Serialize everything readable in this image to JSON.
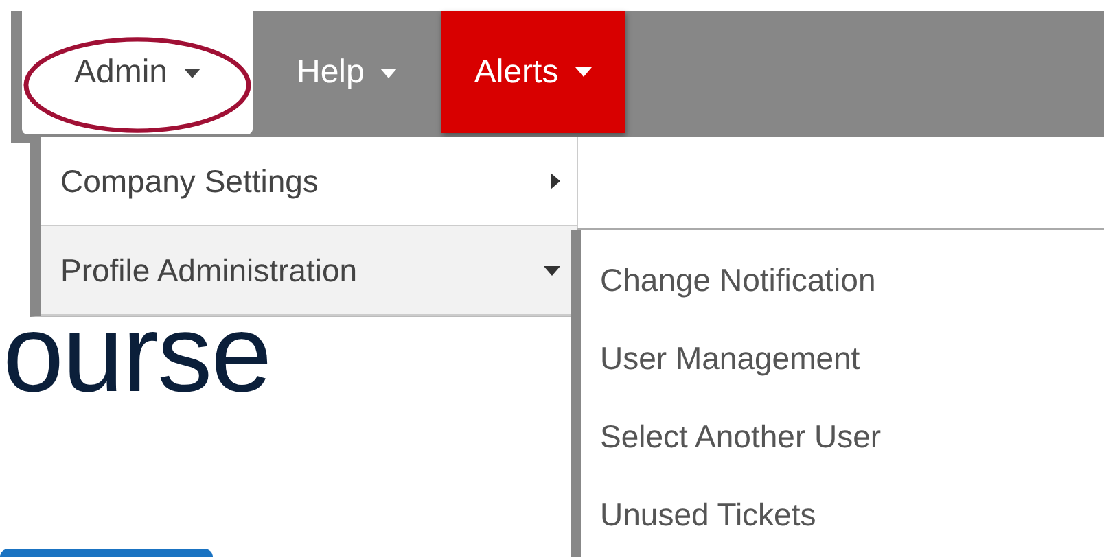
{
  "nav_menu": [
    {
      "label": "Admin",
      "kind": "plain",
      "expanded": true,
      "circled": true
    },
    {
      "label": "Help",
      "kind": "plain",
      "expanded": false,
      "circled": false
    },
    {
      "label": "Alerts",
      "kind": "alert",
      "expanded": false,
      "circled": false
    }
  ],
  "dropdown": {
    "items": [
      {
        "label": "Company Settings",
        "expanded": false,
        "selected": false
      },
      {
        "label": "Profile Administration",
        "expanded": true,
        "selected": true
      }
    ]
  },
  "submenu": {
    "items": [
      {
        "label": "Change Notification"
      },
      {
        "label": "User Management"
      },
      {
        "label": "Select Another User"
      },
      {
        "label": "Unused Tickets"
      }
    ]
  },
  "page": {
    "heading": "ourse"
  }
}
